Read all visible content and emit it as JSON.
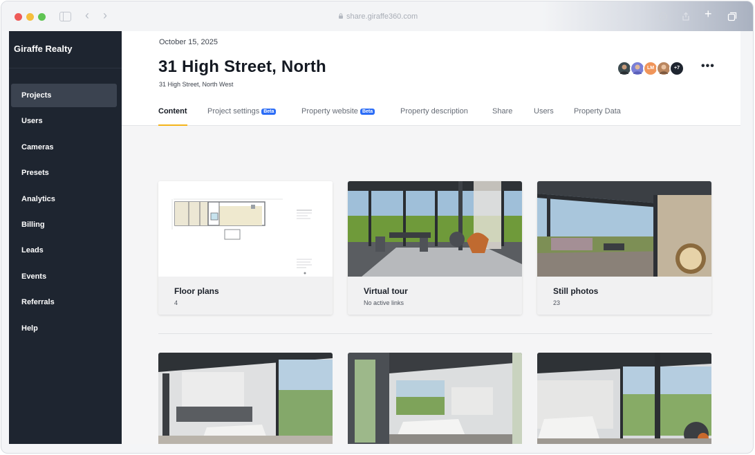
{
  "browser": {
    "url": "share.giraffe360.com"
  },
  "sidebar": {
    "brand": "Giraffe Realty",
    "items": [
      {
        "label": "Projects",
        "active": true
      },
      {
        "label": "Users"
      },
      {
        "label": "Cameras"
      },
      {
        "label": "Presets"
      },
      {
        "label": "Analytics"
      },
      {
        "label": "Billing"
      },
      {
        "label": "Leads"
      },
      {
        "label": "Events"
      },
      {
        "label": "Referrals"
      },
      {
        "label": "Help"
      }
    ]
  },
  "header": {
    "date": "October 15, 2025",
    "title": "31 High Street, North",
    "subtitle": "31 High Street, North West",
    "avatars": [
      {
        "initials": "",
        "color": "#3d4b4f"
      },
      {
        "initials": "",
        "color": "#7a7fd6"
      },
      {
        "initials": "LM",
        "color": "#f0955a"
      },
      {
        "initials": "",
        "color": "#b9865f"
      },
      {
        "initials": "+7",
        "color": "#1f2530"
      }
    ],
    "more": "•••"
  },
  "tabs": [
    {
      "label": "Content",
      "active": true,
      "beta": ""
    },
    {
      "label": "Project settings",
      "beta": "Beta"
    },
    {
      "label": "Property website",
      "beta": "Beta"
    },
    {
      "label": "Property description",
      "beta": ""
    },
    {
      "label": "Share",
      "beta": ""
    },
    {
      "label": "Users",
      "beta": ""
    },
    {
      "label": "Property Data",
      "beta": ""
    }
  ],
  "cards": [
    {
      "title": "Floor plans",
      "sub": "4"
    },
    {
      "title": "Virtual tour",
      "sub": "No active links"
    },
    {
      "title": "Still photos",
      "sub": "23"
    }
  ],
  "colors": {
    "sidebar_bg": "#1e2530",
    "active_tab_underline": "#f4b41a",
    "beta_badge": "#2b6cf6"
  }
}
